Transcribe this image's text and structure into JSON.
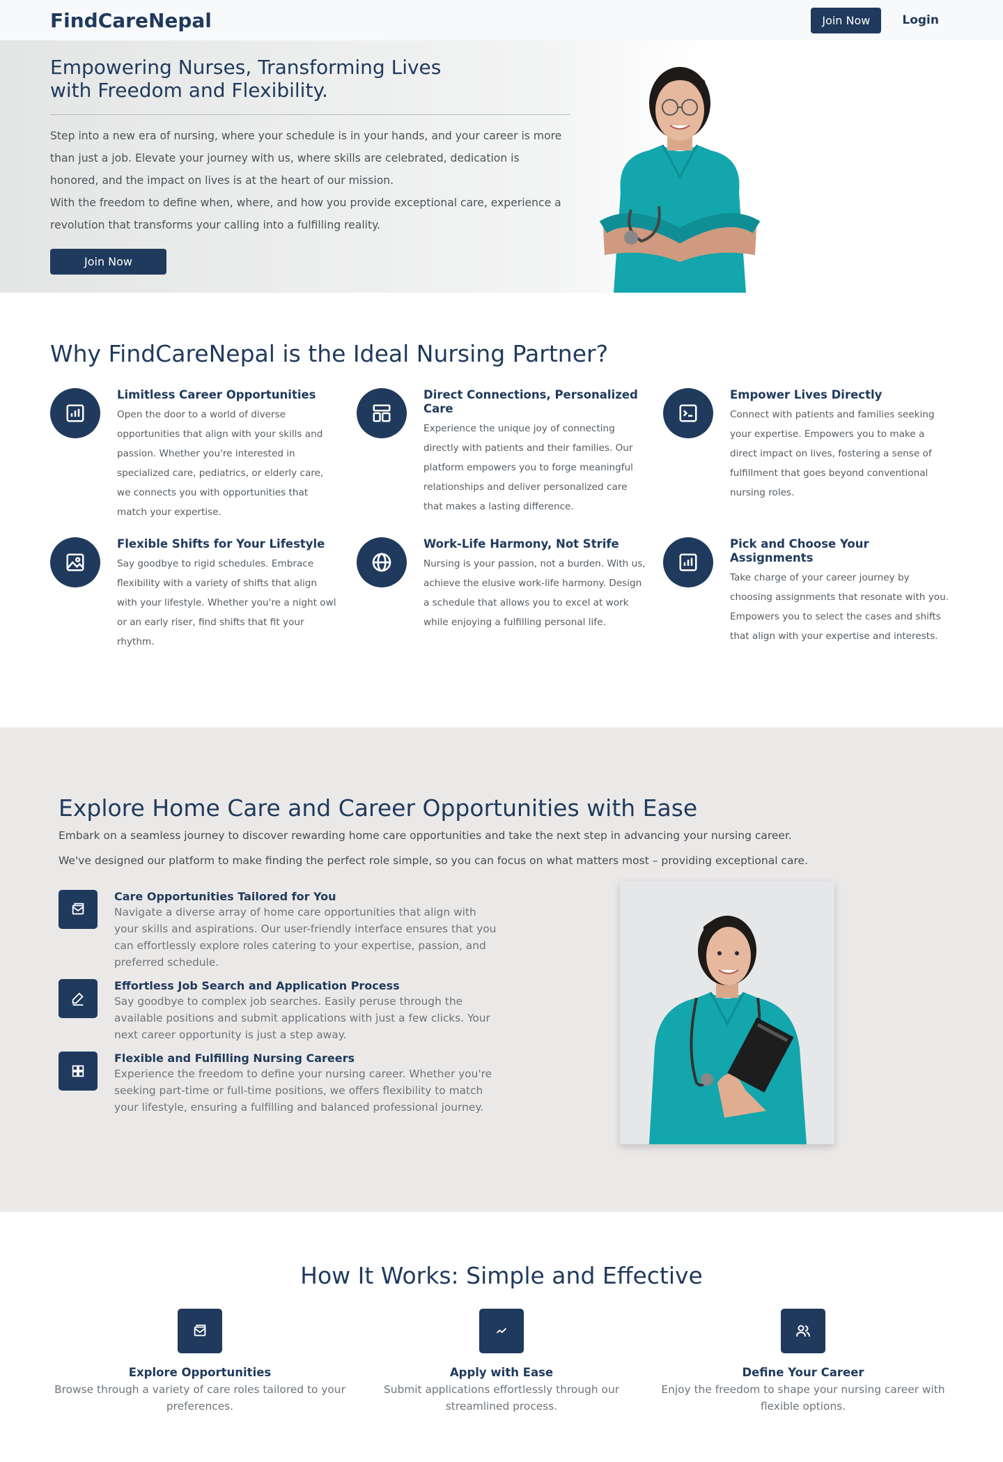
{
  "nav": {
    "brand": "FindCareNepal",
    "join_label": "Join Now",
    "login_label": "Login"
  },
  "hero": {
    "title_line1": "Empowering Nurses, Transforming Lives",
    "title_line2": "with Freedom and Flexibility.",
    "paragraph1": "Step into a new era of nursing, where your schedule is in your hands, and your career is more than just a job. Elevate your journey with us, where skills are celebrated, dedication is honored, and the impact on lives is at the heart of our mission.",
    "paragraph2": "With the freedom to define when, where, and how you provide exceptional care, experience a revolution that transforms your calling into a fulfilling reality.",
    "join_label": "Join Now"
  },
  "why": {
    "title": "Why FindCareNepal is the Ideal Nursing Partner?",
    "features": [
      {
        "icon": "bar-chart-icon",
        "title": "Limitless Career Opportunities",
        "text": "Open the door to a world of diverse opportunities that align with your skills and passion. Whether you're interested in specialized care, pediatrics, or elderly care, we connects you with opportunities that match your expertise."
      },
      {
        "icon": "layout-icon",
        "title": "Direct Connections, Personalized Care",
        "text": "Experience the unique joy of connecting directly with patients and their families. Our platform empowers you to forge meaningful relationships and deliver personalized care that makes a lasting difference."
      },
      {
        "icon": "terminal-icon",
        "title": "Empower Lives Directly",
        "text": "Connect with patients and families seeking your expertise. Empowers you to make a direct impact on lives, fostering a sense of fulfillment that goes beyond conventional nursing roles."
      },
      {
        "icon": "image-icon",
        "title": "Flexible Shifts for Your Lifestyle",
        "text": "Say goodbye to rigid schedules. Embrace flexibility with a variety of shifts that align with your lifestyle. Whether you're a night owl or an early riser, find shifts that fit your rhythm."
      },
      {
        "icon": "globe-icon",
        "title": "Work-Life Harmony, Not Strife",
        "text": "Nursing is your passion, not a burden. With us, achieve the elusive work-life harmony. Design a schedule that allows you to excel at work while enjoying a fulfilling personal life."
      },
      {
        "icon": "bar-chart-icon",
        "title": "Pick and Choose Your Assignments",
        "text": "Take charge of your career journey by choosing assignments that resonate with you. Empowers you to select the cases and shifts that align with your expertise and interests."
      }
    ]
  },
  "explore": {
    "title": "Explore Home Care and Career Opportunities with Ease",
    "sub1": "Embark on a seamless journey to discover rewarding home care opportunities and take the next step in advancing your nursing career.",
    "sub2": "We've designed our platform to make finding the perfect role simple, so you can focus on what matters most – providing exceptional care.",
    "items": [
      {
        "icon": "envelope-icon",
        "title": "Care Opportunities Tailored for You",
        "text": "Navigate a diverse array of home care opportunities that align with your skills and aspirations. Our user-friendly interface ensures that you can effortlessly explore roles catering to your expertise, passion, and preferred schedule."
      },
      {
        "icon": "pencil-icon",
        "title": "Effortless Job Search and Application Process",
        "text": "Say goodbye to complex job searches. Easily peruse through the available positions and submit applications with just a few clicks. Your next career opportunity is just a step away."
      },
      {
        "icon": "grid-icon",
        "title": "Flexible and Fulfilling Nursing Careers",
        "text": "Experience the freedom to define your nursing career. Whether you're seeking part-time or full-time positions, we offers flexibility to match your lifestyle, ensuring a fulfilling and balanced professional journey."
      }
    ]
  },
  "how": {
    "title": "How It Works: Simple and Effective",
    "steps": [
      {
        "icon": "envelope-icon",
        "title": "Explore Opportunities",
        "text": "Browse through a variety of care roles tailored to your preferences."
      },
      {
        "icon": "trend-icon",
        "title": "Apply with Ease",
        "text": "Submit applications effortlessly through our streamlined process."
      },
      {
        "icon": "users-icon",
        "title": "Define Your Career",
        "text": "Enjoy the freedom to shape your nursing career with flexible options."
      }
    ]
  }
}
